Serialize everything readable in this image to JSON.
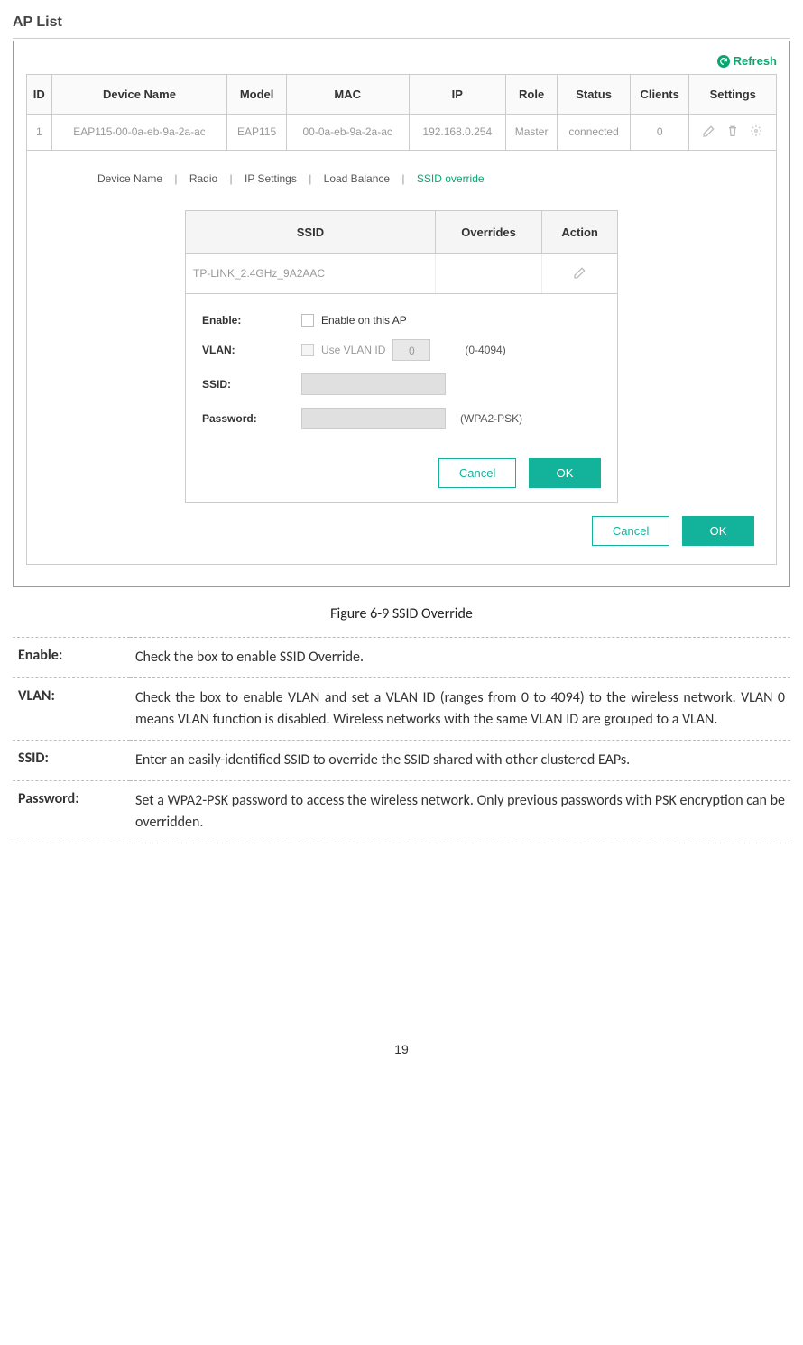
{
  "header": {
    "title": "AP List"
  },
  "refresh": {
    "label": "Refresh"
  },
  "table": {
    "headers": [
      "ID",
      "Device Name",
      "Model",
      "MAC",
      "IP",
      "Role",
      "Status",
      "Clients",
      "Settings"
    ],
    "row": {
      "id": "1",
      "device_name": "EAP115-00-0a-eb-9a-2a-ac",
      "model": "EAP115",
      "mac": "00-0a-eb-9a-2a-ac",
      "ip": "192.168.0.254",
      "role": "Master",
      "status": "connected",
      "clients": "0"
    }
  },
  "subtabs": {
    "items": [
      "Device Name",
      "Radio",
      "IP Settings",
      "Load Balance",
      "SSID override"
    ]
  },
  "ssid_table": {
    "headers": [
      "SSID",
      "Overrides",
      "Action"
    ],
    "row": {
      "ssid": "TP-LINK_2.4GHz_9A2AAC",
      "overrides": ""
    }
  },
  "form": {
    "enable": {
      "label": "Enable:",
      "checkbox_label": "Enable on this AP"
    },
    "vlan": {
      "label": "VLAN:",
      "checkbox_label": "Use VLAN ID",
      "value": "0",
      "hint": "(0-4094)"
    },
    "ssid": {
      "label": "SSID:"
    },
    "password": {
      "label": "Password:",
      "hint": "(WPA2-PSK)"
    },
    "cancel": "Cancel",
    "ok": "OK"
  },
  "outer_buttons": {
    "cancel": "Cancel",
    "ok": "OK"
  },
  "figure": {
    "caption": "Figure 6-9 SSID Override"
  },
  "descriptions": [
    {
      "label": "Enable:",
      "text": "Check the box to enable SSID Override."
    },
    {
      "label": "VLAN:",
      "text": "Check the box to enable VLAN and set a VLAN ID (ranges from 0 to 4094) to the wireless network. VLAN 0 means VLAN function is disabled. Wireless networks with the same VLAN ID are grouped to a VLAN."
    },
    {
      "label": "SSID:",
      "text": "Enter an easily-identified SSID to override the SSID shared with other clustered EAPs."
    },
    {
      "label": "Password:",
      "text": "Set a WPA2-PSK password to access the wireless network. Only previous passwords with PSK encryption can be overridden."
    }
  ],
  "page_number": "19"
}
